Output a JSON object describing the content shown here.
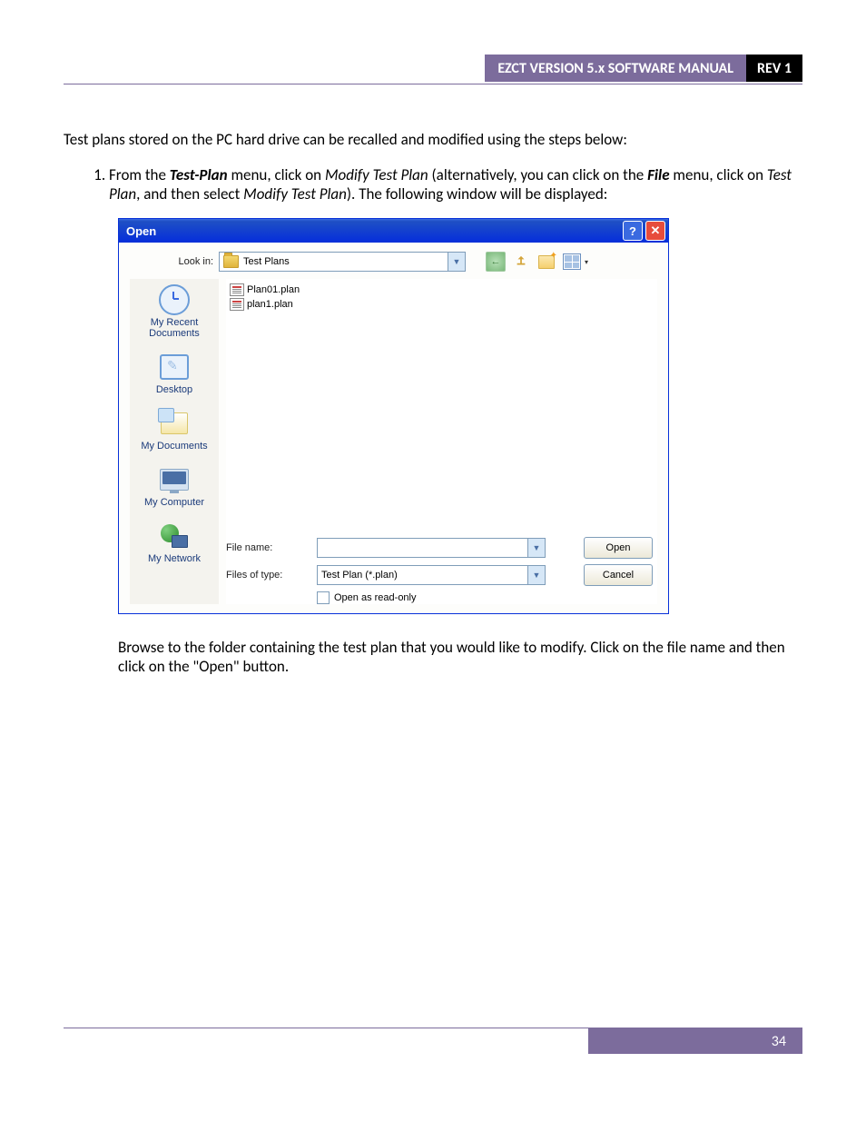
{
  "header": {
    "title": "EZCT VERSION 5.x SOFTWARE MANUAL",
    "rev": "REV 1"
  },
  "intro": "Test plans stored on the PC hard drive can be recalled and modified using the steps below:",
  "step1": {
    "prefix": "From the ",
    "menu_name": "Test-Plan",
    "mid1": " menu, click on ",
    "item1": "Modify Test Plan",
    "mid2": " (alternatively, you can click on the ",
    "file_menu": "File",
    "mid3": " menu, click on ",
    "item2": "Test Plan",
    "mid4": ", and then select ",
    "item3": "Modify Test Plan",
    "suffix": "). The following window will be displayed:"
  },
  "dialog": {
    "title": "Open",
    "lookin_label": "Look in:",
    "lookin_value": "Test Plans",
    "places": {
      "recent": "My Recent Documents",
      "desktop": "Desktop",
      "documents": "My Documents",
      "computer": "My Computer",
      "network": "My Network"
    },
    "files": [
      "Plan01.plan",
      "plan1.plan"
    ],
    "filename_label": "File name:",
    "filename_value": "",
    "filetype_label": "Files of type:",
    "filetype_value": "Test Plan (*.plan)",
    "readonly_label": "Open as read-only",
    "open_btn": "Open",
    "cancel_btn": "Cancel"
  },
  "after": "Browse to the folder containing the test plan that you would like to modify. Click on the file name and then click on the \"Open\" button.",
  "page_number": "34"
}
